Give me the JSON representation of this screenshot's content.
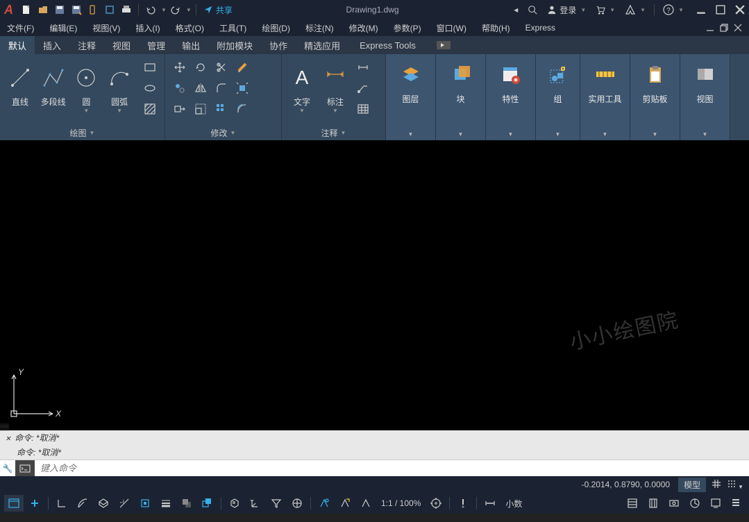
{
  "titlebar": {
    "share": "共享",
    "doc_name": "Drawing1.dwg",
    "login": "登录"
  },
  "menubar": {
    "file": "文件(F)",
    "edit": "编辑(E)",
    "view": "视图(V)",
    "insert": "插入(I)",
    "format": "格式(O)",
    "tools": "工具(T)",
    "draw": "绘图(D)",
    "dimension": "标注(N)",
    "modify": "修改(M)",
    "parametric": "参数(P)",
    "window": "窗口(W)",
    "help": "帮助(H)",
    "express": "Express"
  },
  "tabs": {
    "default": "默认",
    "insert": "插入",
    "annotate": "注释",
    "view": "视图",
    "manage": "管理",
    "output": "输出",
    "addins": "附加模块",
    "collab": "协作",
    "featured": "精选应用",
    "express": "Express Tools"
  },
  "ribbon": {
    "draw_panel": "绘图",
    "line": "直线",
    "polyline": "多段线",
    "circle": "圆",
    "arc": "圆弧",
    "modify_panel": "修改",
    "annotate_panel": "注释",
    "text": "文字",
    "dim": "标注",
    "layers": "图层",
    "block": "块",
    "properties": "特性",
    "group": "组",
    "utilities": "实用工具",
    "clipboard": "剪贴板",
    "view": "视图"
  },
  "watermark": "小小绘图院",
  "command": {
    "h1_label": "命令:",
    "h1_val": "*取消*",
    "h2_label": "命令:",
    "h2_val": "*取消*",
    "placeholder": "键入命令"
  },
  "status": {
    "coords": "-0.2014, 0.8790, 0.0000",
    "model": "模型",
    "scale": "1:1 / 100%",
    "decimal": "小数"
  }
}
